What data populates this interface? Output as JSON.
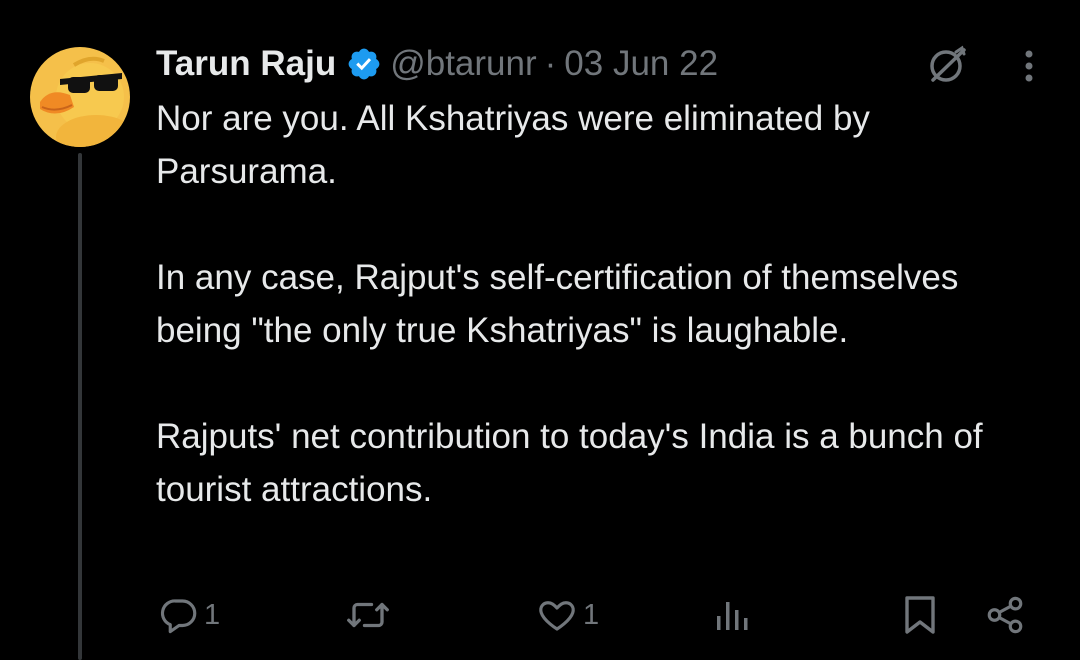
{
  "tweet": {
    "author_name": "Tarun Raju",
    "handle": "@btarunr",
    "separator": "·",
    "date": "03 Jun 22",
    "paragraphs": [
      "Nor are you. All Kshatriyas were eliminated by Parsurama.",
      "In any case, Rajput's self-certification of themselves being \"the only true Kshatriyas\" is laughable.",
      "Rajputs' net contribution to today's India is a bunch of tourist attractions."
    ],
    "verified": true
  },
  "icons": {
    "verified": "verified-badge-icon",
    "grok": "grok-icon",
    "more": "more-options-icon",
    "reply": "reply-icon",
    "retweet": "retweet-icon",
    "like": "like-icon",
    "views": "views-icon",
    "bookmark": "bookmark-icon",
    "share": "share-icon"
  },
  "actions": {
    "reply_count": "1",
    "like_count": "1"
  },
  "colors": {
    "background": "#000000",
    "text": "#e7e9ea",
    "muted": "#71767b",
    "verified": "#1d9bf0",
    "thread_line": "#333639",
    "avatar_bg": "#f5c04a"
  }
}
